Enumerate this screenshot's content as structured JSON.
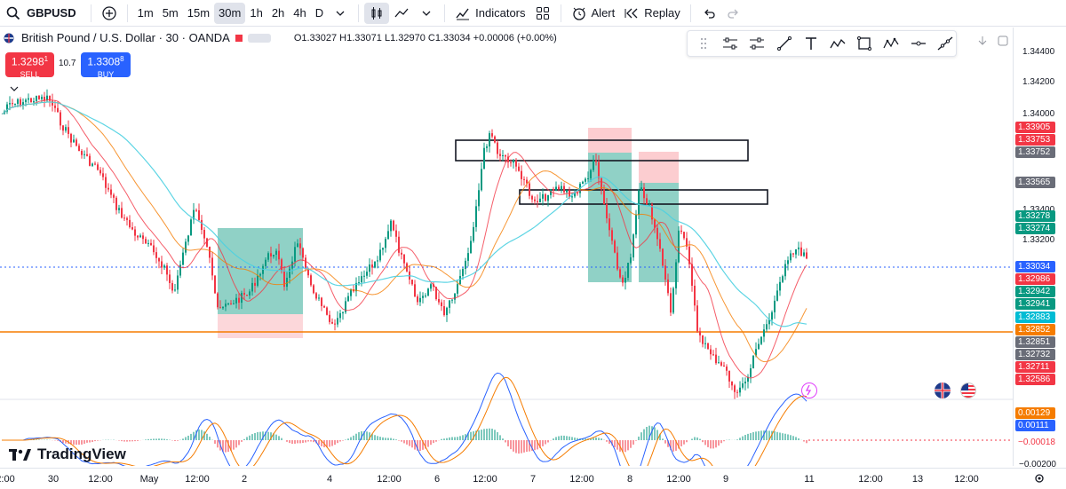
{
  "toolbar": {
    "symbol": "GBPUSD",
    "timeframes": [
      "1m",
      "5m",
      "15m",
      "30m",
      "1h",
      "2h",
      "4h",
      "D"
    ],
    "active_timeframe": "30m",
    "indicators_label": "Indicators",
    "alert_label": "Alert",
    "replay_label": "Replay"
  },
  "legend": {
    "title": "British Pound / U.S. Dollar · 30 · OANDA",
    "ohlc": "O1.33027 H1.33071 L1.32970 C1.33034 +0.00006 (+0.00%)"
  },
  "trade": {
    "sell_price": "1.3298",
    "sell_sup": "1",
    "sell_label": "SELL",
    "spread": "10.7",
    "buy_price": "1.3308",
    "buy_sup": "8",
    "buy_label": "BUY"
  },
  "price_ticks": [
    "1.34400",
    "1.34200",
    "1.34000",
    "1.33400",
    "1.33200"
  ],
  "price_labels": [
    {
      "text": "1.33905",
      "color": "#f23645"
    },
    {
      "text": "1.33753",
      "color": "#f23645"
    },
    {
      "text": "1.33752",
      "color": "#6a6d78"
    },
    {
      "text": "1.33565",
      "color": "#6a6d78"
    },
    {
      "text": "1.33278",
      "color": "#089981"
    },
    {
      "text": "1.33274",
      "color": "#089981"
    },
    {
      "text": "1.33034",
      "color": "#2962ff"
    },
    {
      "text": "1.32986",
      "color": "#f23645"
    },
    {
      "text": "1.32942",
      "color": "#089981"
    },
    {
      "text": "1.32941",
      "color": "#089981"
    },
    {
      "text": "1.32883",
      "color": "#00bcd4"
    },
    {
      "text": "1.32852",
      "color": "#f57c00"
    },
    {
      "text": "1.32851",
      "color": "#6a6d78"
    },
    {
      "text": "1.32732",
      "color": "#6a6d78"
    },
    {
      "text": "1.32711",
      "color": "#f23645"
    },
    {
      "text": "1.32586",
      "color": "#f23645"
    }
  ],
  "osc_labels": [
    {
      "text": "0.00129",
      "color": "#f57c00"
    },
    {
      "text": "0.00111",
      "color": "#2962ff"
    },
    {
      "text": "−0.00018",
      "color": "#f23645"
    }
  ],
  "osc_tick": "−0.00200",
  "time_labels": [
    "2:00",
    "30",
    "12:00",
    "May",
    "12:00",
    "2",
    "4",
    "12:00",
    "6",
    "12:00",
    "7",
    "12:00",
    "8",
    "12:00",
    "9",
    "11",
    "12:00",
    "13",
    "12:00"
  ],
  "logo_text": "TradingView",
  "icons": {
    "search": "search-icon",
    "add": "add-symbol-icon",
    "candles": "candles-icon",
    "line": "line-chart-icon",
    "indicators": "indicators-icon",
    "templates": "templates-icon",
    "alert": "alert-icon",
    "replay": "replay-icon",
    "undo": "undo-icon",
    "redo": "redo-icon"
  },
  "colors": {
    "up": "#089981",
    "down": "#f23645",
    "accent": "#2962ff",
    "orange_line": "#f57c00"
  }
}
